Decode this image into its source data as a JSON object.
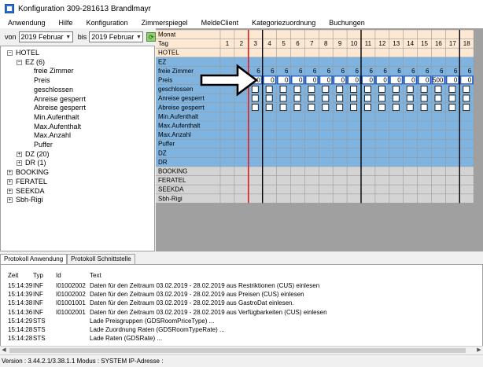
{
  "window": {
    "title": "Konfiguration 309-281613 Brandlmayr"
  },
  "menu": [
    "Anwendung",
    "Hilfe",
    "Konfiguration",
    "Zimmerspiegel",
    "MeldeClient",
    "Kategoriezuordnung",
    "Buchungen"
  ],
  "filter": {
    "from_label": "von",
    "from_value": "2019 Februar",
    "to_label": "bis",
    "to_value": "2019 Februar"
  },
  "tree": [
    {
      "label": "HOTEL",
      "level": 0,
      "expander": "-"
    },
    {
      "label": "EZ (6)",
      "level": 1,
      "expander": "-"
    },
    {
      "label": "freie Zimmer",
      "level": 2
    },
    {
      "label": "Preis",
      "level": 2
    },
    {
      "label": "geschlossen",
      "level": 2
    },
    {
      "label": "Anreise gesperrt",
      "level": 2
    },
    {
      "label": "Abreise gesperrt",
      "level": 2
    },
    {
      "label": "Min.Aufenthalt",
      "level": 2
    },
    {
      "label": "Max.Aufenthalt",
      "level": 2
    },
    {
      "label": "Max.Anzahl",
      "level": 2
    },
    {
      "label": "Puffer",
      "level": 2
    },
    {
      "label": "DZ (20)",
      "level": 1,
      "expander": "+"
    },
    {
      "label": "DR (1)",
      "level": 1,
      "expander": "+"
    },
    {
      "label": "BOOKING",
      "level": 0,
      "expander": "+"
    },
    {
      "label": "FERATEL",
      "level": 0,
      "expander": "+"
    },
    {
      "label": "SEEKDA",
      "level": 0,
      "expander": "+"
    },
    {
      "label": "Sbh-Rigi",
      "level": 0,
      "expander": "+"
    }
  ],
  "grid": {
    "monat_label": "Monat",
    "tag_label": "Tag",
    "days": [
      "1",
      "2",
      "3",
      "4",
      "5",
      "6",
      "7",
      "8",
      "9",
      "10",
      "11",
      "12",
      "13",
      "14",
      "15",
      "16",
      "17",
      "18"
    ],
    "rows": [
      {
        "label": "HOTEL",
        "kind": "hotel"
      },
      {
        "label": "EZ",
        "kind": "cat"
      },
      {
        "label": "freie Zimmer",
        "kind": "num",
        "values": [
          "",
          "",
          "6",
          "6",
          "6",
          "6",
          "6",
          "6",
          "6",
          "6",
          "6",
          "6",
          "6",
          "6",
          "6",
          "6",
          "6",
          "6"
        ]
      },
      {
        "label": "Preis",
        "kind": "price",
        "values": [
          "",
          "",
          "0",
          "0",
          "0",
          "0",
          "0",
          "0",
          "0",
          "0",
          "0",
          "0",
          "0",
          "0",
          "0",
          "500",
          "0",
          "0"
        ]
      },
      {
        "label": "geschlossen",
        "kind": "check"
      },
      {
        "label": "Anreise gesperrt",
        "kind": "check"
      },
      {
        "label": "Abreise gesperrt",
        "kind": "check"
      },
      {
        "label": "Min.Aufenthalt",
        "kind": "empty"
      },
      {
        "label": "Max.Aufenthalt",
        "kind": "empty"
      },
      {
        "label": "Max.Anzahl",
        "kind": "empty"
      },
      {
        "label": "Puffer",
        "kind": "empty"
      },
      {
        "label": "DZ",
        "kind": "cat"
      },
      {
        "label": "DR",
        "kind": "cat"
      },
      {
        "label": "BOOKING",
        "kind": "gray"
      },
      {
        "label": "FERATEL",
        "kind": "gray"
      },
      {
        "label": "SEEKDA",
        "kind": "gray"
      },
      {
        "label": "Sbh-Rigi",
        "kind": "gray"
      }
    ]
  },
  "colors": {
    "header": "#fde9d3",
    "blue": "#7fb4e0",
    "selected": "#1a5fd0",
    "gray": "#d4d4d4",
    "today_line": "#e02020"
  },
  "tabs": [
    "Protokoll Anwendung",
    "Protokoll Schnittstelle"
  ],
  "log": {
    "headers": [
      "Zeit",
      "Typ",
      "Id",
      "Text"
    ],
    "rows": [
      [
        "15:14:39",
        "INF",
        "I01002002",
        "Daten für den Zeitraum 03.02.2019 - 28.02.2019 aus Restriktionen (CUS) einlesen"
      ],
      [
        "15:14:39",
        "INF",
        "I01002002",
        "Daten für den Zeitraum 03.02.2019 - 28.02.2019 aus Preisen (CUS) einlesen"
      ],
      [
        "15:14:38",
        "INF",
        "I01001001",
        "Daten für den Zeitraum 03.02.2019 - 28.02.2019 aus GastroDat einlesen."
      ],
      [
        "15:14:36",
        "INF",
        "I01002001",
        "Daten für den Zeitraum 03.02.2019 - 28.02.2019 aus Verfügbarkeiten (CUS) einlesen"
      ],
      [
        "15:14:29",
        "STS",
        "",
        "Lade Preisgruppen (GDSRoomPriceType) ..."
      ],
      [
        "15:14:28",
        "STS",
        "",
        "Lade Zuordnung Raten (GDSRoomTypeRate) ..."
      ],
      [
        "15:14:28",
        "STS",
        "",
        "Lade Raten (GDSRate) ..."
      ]
    ]
  },
  "status": "Version : 3.44.2.1/3.38.1.1 Modus : SYSTEM IP-Adresse :"
}
